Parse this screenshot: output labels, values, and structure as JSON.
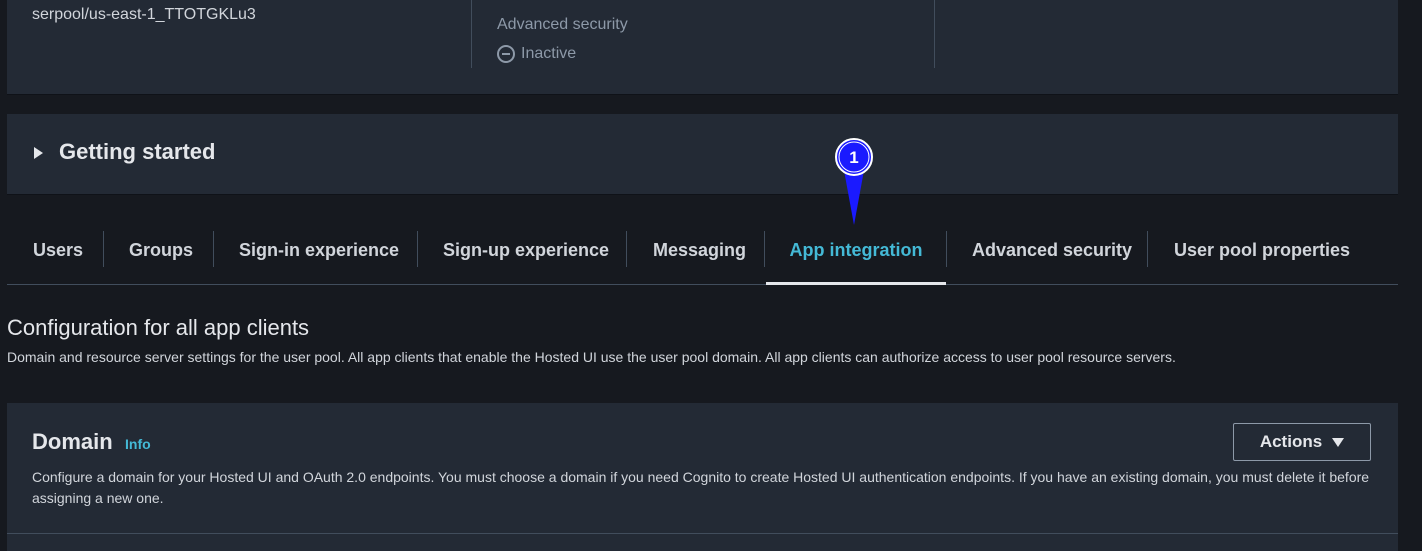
{
  "summary": {
    "pool_id": "serpool/us-east-1_TTOTGKLu3",
    "advanced_security_label": "Advanced security",
    "advanced_security_status": "Inactive",
    "status_icon": "minus-circle-icon"
  },
  "getting_started": {
    "title": "Getting started",
    "caret_icon": "caret-right-icon"
  },
  "tabs": [
    {
      "label": "Users",
      "active": false
    },
    {
      "label": "Groups",
      "active": false
    },
    {
      "label": "Sign-in experience",
      "active": false
    },
    {
      "label": "Sign-up experience",
      "active": false
    },
    {
      "label": "Messaging",
      "active": false
    },
    {
      "label": "App integration",
      "active": true
    },
    {
      "label": "Advanced security",
      "active": false
    },
    {
      "label": "User pool properties",
      "active": false
    }
  ],
  "marker": {
    "label": "1",
    "color": "#1a1aff"
  },
  "config": {
    "title": "Configuration for all app clients",
    "description": "Domain and resource server settings for the user pool. All app clients that enable the Hosted UI use the user pool domain. All app clients can authorize access to user pool resource servers."
  },
  "domain": {
    "title": "Domain",
    "info": "Info",
    "actions_label": "Actions",
    "actions_icon": "caret-down-icon",
    "description": "Configure a domain for your Hosted UI and OAuth 2.0 endpoints. You must choose a domain if you need Cognito to create Hosted UI authentication endpoints. If you have an existing domain, you must delete it before assigning a new one."
  },
  "colors": {
    "accent": "#44b9d6",
    "panel": "#232a35",
    "background": "#16191f"
  }
}
